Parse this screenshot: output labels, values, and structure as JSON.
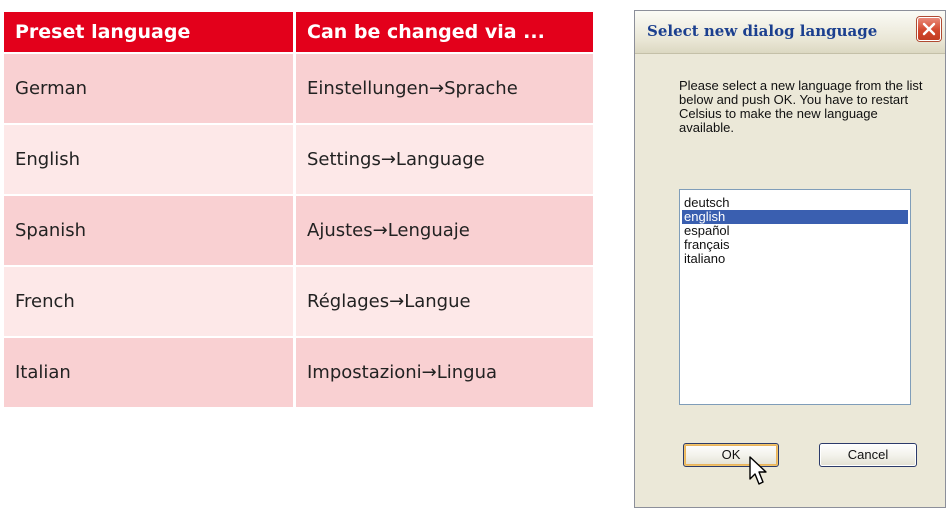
{
  "table": {
    "headers": [
      "Preset language",
      "Can be changed via ..."
    ],
    "rows": [
      {
        "language": "German",
        "path": "Einstellungen→Sprache"
      },
      {
        "language": "English",
        "path": "Settings→Language"
      },
      {
        "language": "Spanish",
        "path": "Ajustes→Lenguaje"
      },
      {
        "language": "French",
        "path": "Réglages→Langue"
      },
      {
        "language": "Italian",
        "path": "Impostazioni→Lingua"
      }
    ]
  },
  "dialog": {
    "title": "Select new dialog language",
    "instructions": "Please select a new language from the list below and push OK. You have to restart Celsius to make the new language available.",
    "languages": [
      "deutsch",
      "english",
      "español",
      "français",
      "italiano"
    ],
    "selected_language": "english",
    "ok_label": "OK",
    "cancel_label": "Cancel",
    "close_icon": "close-icon",
    "cursor_icon": "mouse-pointer-icon"
  },
  "colors": {
    "header_red": "#e3001b",
    "row_dark": "#f9d0d2",
    "row_light": "#fde8e8",
    "dialog_bg": "#ebe8d8",
    "title_text": "#1b3f8f",
    "selection": "#3a5fb0"
  }
}
